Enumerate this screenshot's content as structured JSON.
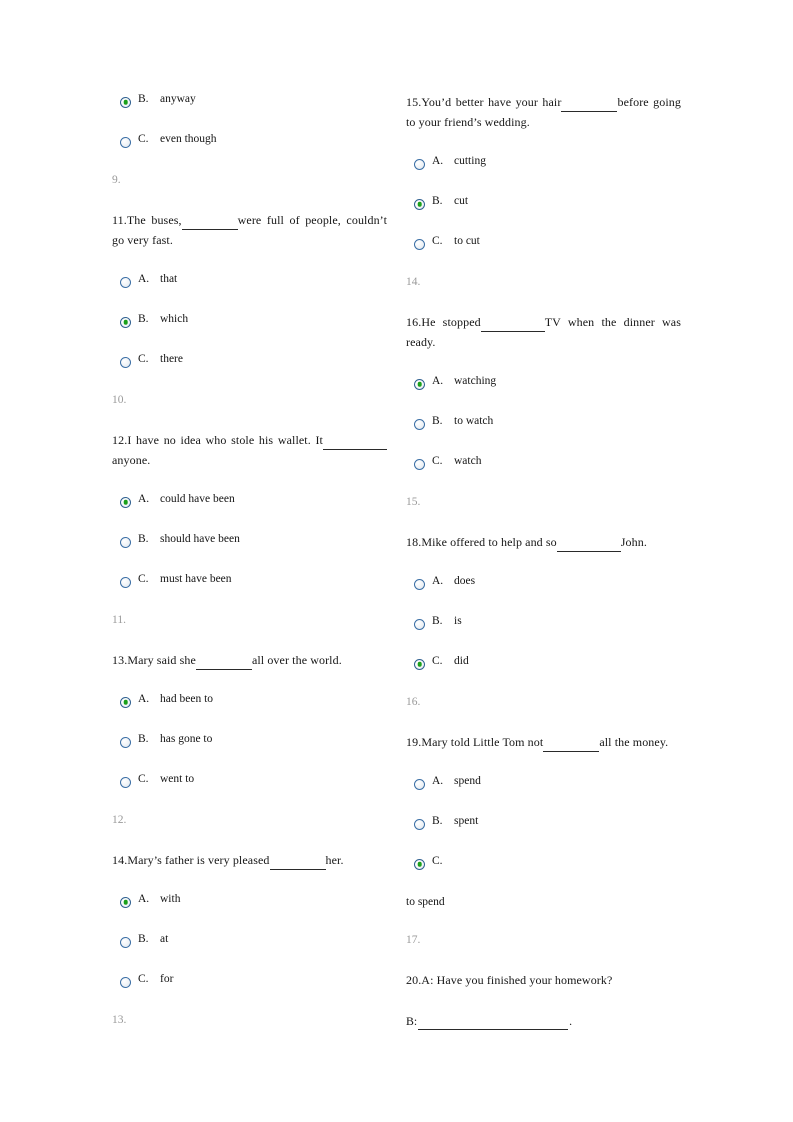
{
  "document": {
    "type": "exam-worksheet",
    "page_background": "#ffffff",
    "accent_radio_ring": "#3a6ea5",
    "accent_radio_dot": "#1aa01a",
    "section_number_color": "#9a9a9a"
  },
  "left_column": {
    "blocks": [
      {
        "kind": "option",
        "letter": "B.",
        "text": "anyway",
        "checked": true
      },
      {
        "kind": "option",
        "letter": "C.",
        "text": "even though",
        "checked": false
      },
      {
        "kind": "section",
        "text": "9."
      },
      {
        "kind": "stem",
        "number": "11.",
        "part1": "The buses,",
        "part2": "were full of people, couldn’t go very fast."
      },
      {
        "kind": "option",
        "letter": "A.",
        "text": "that",
        "checked": false
      },
      {
        "kind": "option",
        "letter": "B.",
        "text": "which",
        "checked": true
      },
      {
        "kind": "option",
        "letter": "C.",
        "text": "there",
        "checked": false
      },
      {
        "kind": "section",
        "text": "10."
      },
      {
        "kind": "stem",
        "number": "12.",
        "part1": "I have no idea who stole his wallet. It",
        "part2": "anyone."
      },
      {
        "kind": "option",
        "letter": "A.",
        "text": "could have been",
        "checked": true
      },
      {
        "kind": "option",
        "letter": "B.",
        "text": "should have been",
        "checked": false
      },
      {
        "kind": "option",
        "letter": "C.",
        "text": "must have been",
        "checked": false
      },
      {
        "kind": "section",
        "text": "11."
      },
      {
        "kind": "stem",
        "number": "13.",
        "part1": "Mary said she",
        "part2": "all over the world."
      },
      {
        "kind": "option",
        "letter": "A.",
        "text": "had been to",
        "checked": true
      },
      {
        "kind": "option",
        "letter": "B.",
        "text": "has gone to",
        "checked": false
      },
      {
        "kind": "option",
        "letter": "C.",
        "text": "went to",
        "checked": false
      },
      {
        "kind": "section",
        "text": "12."
      },
      {
        "kind": "stem",
        "number": "14.",
        "part1": "Mary’s father is very pleased",
        "part2": "her."
      },
      {
        "kind": "option",
        "letter": "A.",
        "text": "with",
        "checked": true
      },
      {
        "kind": "option",
        "letter": "B.",
        "text": "at",
        "checked": false
      },
      {
        "kind": "option",
        "letter": "C.",
        "text": "for",
        "checked": false
      },
      {
        "kind": "section",
        "text": "13."
      }
    ]
  },
  "right_column": {
    "blocks": [
      {
        "kind": "stem",
        "number": "15.",
        "part1": "You’d better have your hair",
        "part2": "before going to your friend’s wedding."
      },
      {
        "kind": "option",
        "letter": "A.",
        "text": "cutting",
        "checked": false
      },
      {
        "kind": "option",
        "letter": "B.",
        "text": "cut",
        "checked": true
      },
      {
        "kind": "option",
        "letter": "C.",
        "text": "to cut",
        "checked": false
      },
      {
        "kind": "section",
        "text": "14."
      },
      {
        "kind": "stem",
        "number": "16.",
        "part1": "He stopped",
        "part2": "TV when the dinner was ready."
      },
      {
        "kind": "option",
        "letter": "A.",
        "text": "watching",
        "checked": true
      },
      {
        "kind": "option",
        "letter": "B.",
        "text": "to watch",
        "checked": false
      },
      {
        "kind": "option",
        "letter": "C.",
        "text": "watch",
        "checked": false
      },
      {
        "kind": "section",
        "text": "15."
      },
      {
        "kind": "stem",
        "number": "18.",
        "part1": "Mike offered to help and so",
        "part2": "John."
      },
      {
        "kind": "option",
        "letter": "A.",
        "text": "does",
        "checked": false
      },
      {
        "kind": "option",
        "letter": "B.",
        "text": "is",
        "checked": false
      },
      {
        "kind": "option",
        "letter": "C.",
        "text": "did",
        "checked": true
      },
      {
        "kind": "section",
        "text": "16."
      },
      {
        "kind": "stem",
        "number": "19.",
        "part1": "Mary told Little Tom not",
        "part2": "all the money."
      },
      {
        "kind": "option",
        "letter": "A.",
        "text": "spend",
        "checked": false
      },
      {
        "kind": "option",
        "letter": "B.",
        "text": "spent",
        "checked": false
      },
      {
        "kind": "option",
        "letter": "C.",
        "text": "",
        "checked": true
      },
      {
        "kind": "loose",
        "text": "to spend"
      },
      {
        "kind": "section",
        "text": "17."
      },
      {
        "kind": "stem_plain",
        "text": "20.A: Have you finished your homework?"
      },
      {
        "kind": "answer",
        "prefix": "B:",
        "suffix": "."
      }
    ]
  }
}
